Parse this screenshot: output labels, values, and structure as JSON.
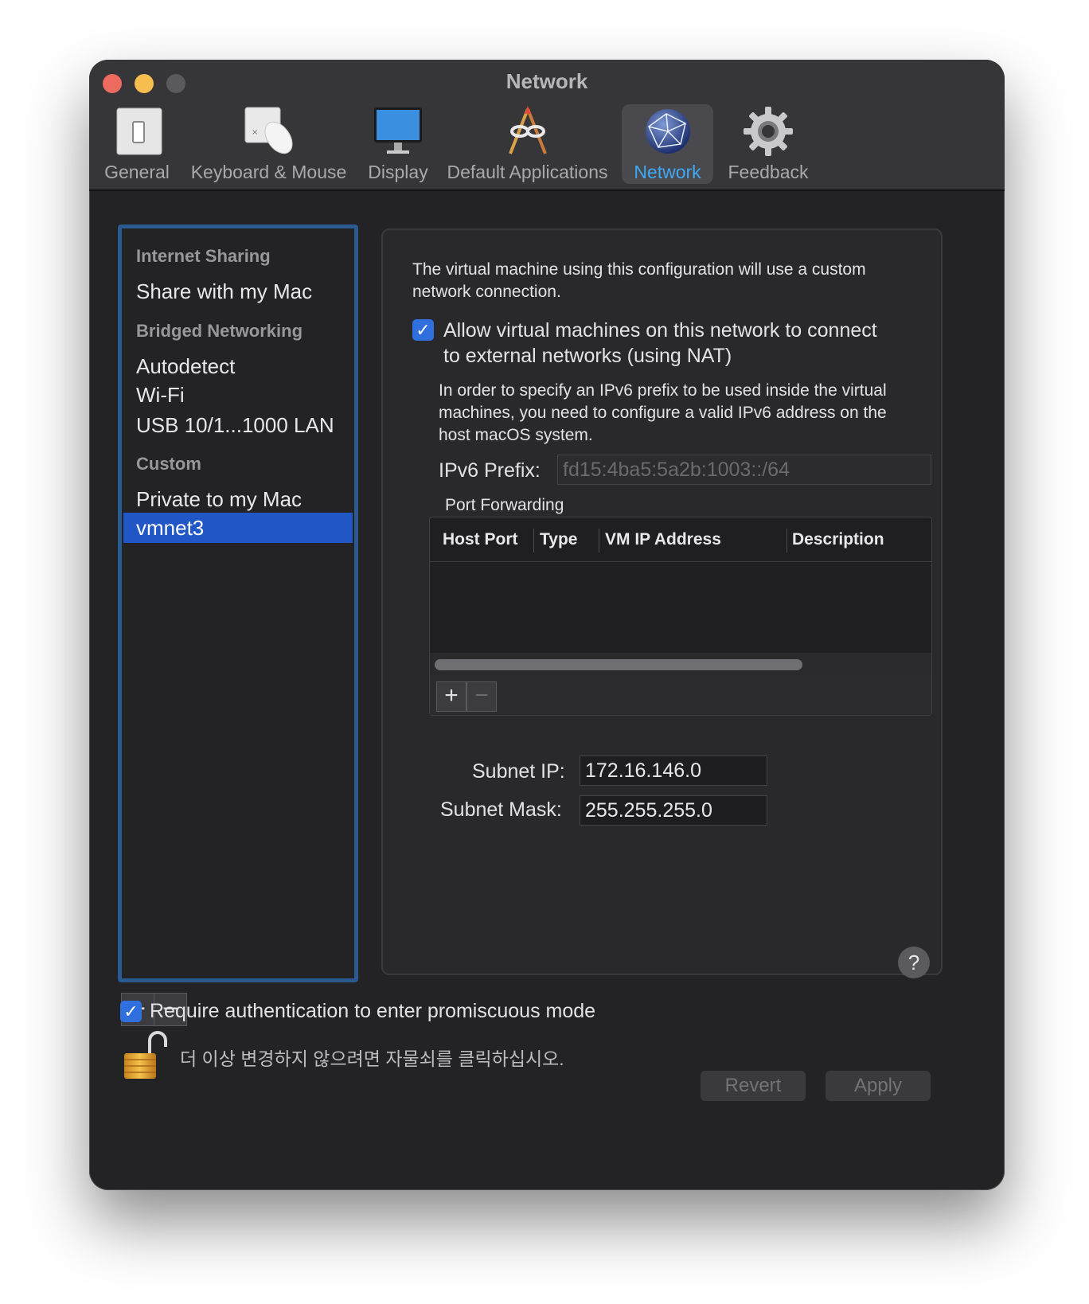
{
  "window": {
    "title": "Network"
  },
  "toolbar": {
    "items": [
      {
        "label": "General",
        "icon": "switch-icon"
      },
      {
        "label": "Keyboard & Mouse",
        "icon": "keyboard-mouse-icon"
      },
      {
        "label": "Display",
        "icon": "display-icon"
      },
      {
        "label": "Default Applications",
        "icon": "default-apps-icon"
      },
      {
        "label": "Network",
        "icon": "globe-icon",
        "active": true
      },
      {
        "label": "Feedback",
        "icon": "gear-icon"
      }
    ]
  },
  "sidebar": {
    "sections": [
      {
        "header": "Internet Sharing",
        "items": [
          "Share with my Mac"
        ]
      },
      {
        "header": "Bridged Networking",
        "items": [
          "Autodetect",
          "Wi-Fi",
          "USB 10/1...1000 LAN"
        ]
      },
      {
        "header": "Custom",
        "items": [
          "Private to my Mac",
          "vmnet3"
        ]
      }
    ],
    "selected": "vmnet3",
    "add_label": "+",
    "remove_label": "−"
  },
  "panel": {
    "description": "The virtual machine using this configuration will use a custom network connection.",
    "nat_checkbox": {
      "checked": true,
      "label_line1": "Allow virtual machines on this network to connect",
      "label_line2": "to external networks (using NAT)"
    },
    "ipv6_note": [
      "In order to specify an IPv6 prefix to be used inside the virtual",
      "machines, you need to configure a valid IPv6 address on the",
      "host macOS system."
    ],
    "ipv6_label": "IPv6 Prefix:",
    "ipv6_value": "fd15:4ba5:5a2b:1003::/64",
    "port_forwarding": {
      "title": "Port Forwarding",
      "columns": [
        "Host Port",
        "Type",
        "VM IP Address",
        "Description"
      ],
      "rows": [],
      "add_label": "+",
      "remove_label": "−"
    },
    "subnet_ip_label": "Subnet IP:",
    "subnet_ip_value": "172.16.146.0",
    "subnet_mask_label": "Subnet Mask:",
    "subnet_mask_value": "255.255.255.0"
  },
  "help_label": "?",
  "promiscuous": {
    "checked": true,
    "label": "Require authentication to enter promiscuous mode"
  },
  "lock_text": "더 이상 변경하지 않으려면 자물쇠를 클릭하십시오.",
  "buttons": {
    "revert": "Revert",
    "apply": "Apply"
  }
}
